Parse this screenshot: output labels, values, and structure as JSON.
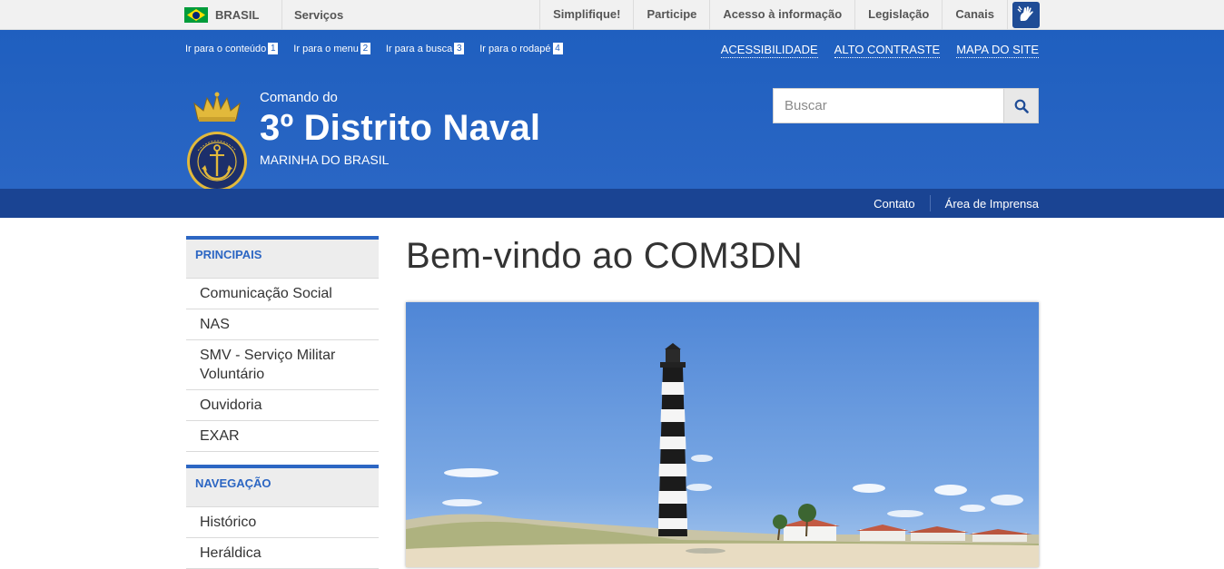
{
  "govbar": {
    "country": "BRASIL",
    "servicos": "Serviços",
    "links": [
      "Simplifique!",
      "Participe",
      "Acesso à informação",
      "Legislação",
      "Canais"
    ]
  },
  "skips": [
    {
      "label": "Ir para o conteúdo",
      "key": "1"
    },
    {
      "label": "Ir para o menu",
      "key": "2"
    },
    {
      "label": "Ir para a busca",
      "key": "3"
    },
    {
      "label": "Ir para o rodapé",
      "key": "4"
    }
  ],
  "access": [
    "ACESSIBILIDADE",
    "ALTO CONTRASTE",
    "MAPA DO SITE"
  ],
  "site": {
    "pre_title": "Comando do",
    "title": "3º Distrito Naval",
    "subtitle": "MARINHA DO BRASIL"
  },
  "search": {
    "placeholder": "Buscar"
  },
  "strip_links": [
    "Contato",
    "Área de Imprensa"
  ],
  "sidebar": {
    "sections": [
      {
        "heading": "PRINCIPAIS",
        "items": [
          "Comunicação Social",
          "NAS",
          "SMV - Serviço Militar Voluntário",
          "Ouvidoria",
          "EXAR"
        ]
      },
      {
        "heading": "NAVEGAÇÃO",
        "items": [
          "Histórico",
          "Heráldica"
        ]
      }
    ]
  },
  "main": {
    "title": "Bem-vindo ao COM3DN"
  },
  "colors": {
    "header_blue": "#2a66c4",
    "strip_blue": "#1a4493",
    "accent": "#2c66c3"
  }
}
